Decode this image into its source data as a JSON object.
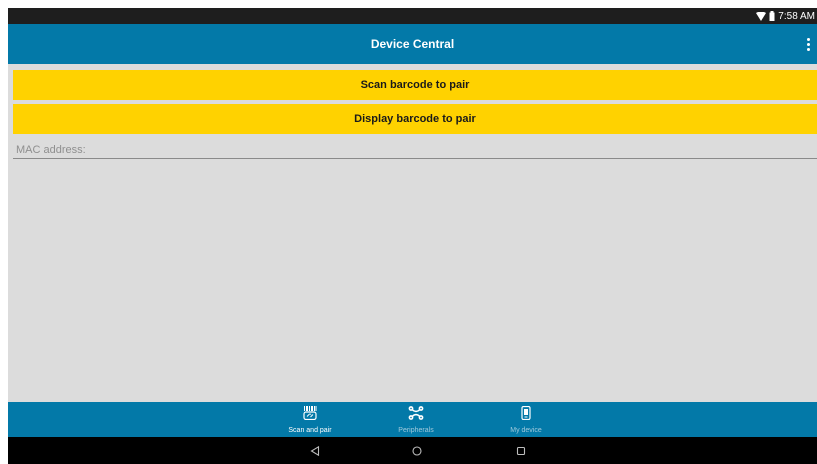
{
  "status_bar": {
    "time": "7:58 AM",
    "icons": [
      "wifi-icon",
      "battery-icon"
    ]
  },
  "app_bar": {
    "title": "Device Central",
    "menu_icon": "more-vert-icon"
  },
  "actions": {
    "scan_label": "Scan barcode to pair",
    "display_label": "Display barcode to pair"
  },
  "mac_field": {
    "placeholder": "MAC address:",
    "value": ""
  },
  "bottom_nav": {
    "items": [
      {
        "label": "Scan and pair",
        "icon": "barcode-link-icon",
        "selected": true
      },
      {
        "label": "Peripherals",
        "icon": "peripherals-icon",
        "selected": false
      },
      {
        "label": "My device",
        "icon": "my-device-icon",
        "selected": false
      }
    ]
  },
  "system_nav": {
    "icons": [
      "back-icon",
      "home-icon",
      "recents-icon"
    ]
  },
  "colors": {
    "app_bar": "#0379a8",
    "button": "#ffd200",
    "background": "#dcdcdc",
    "status_bar": "#1e1e1e"
  }
}
